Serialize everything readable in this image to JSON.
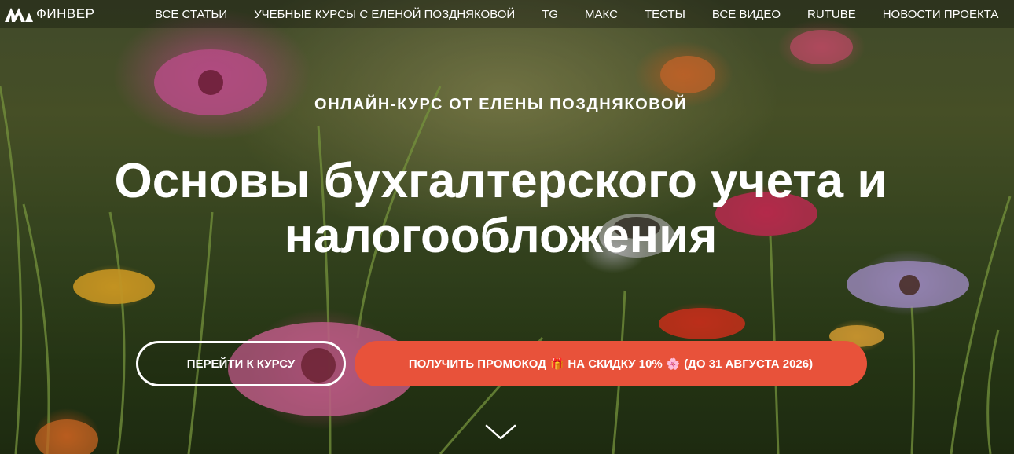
{
  "header": {
    "logo_text": "ФИНВЕР",
    "nav": [
      {
        "label": "ВСЕ СТАТЬИ"
      },
      {
        "label": "УЧЕБНЫЕ КУРСЫ С ЕЛЕНОЙ ПОЗДНЯКОВОЙ"
      },
      {
        "label": "TG"
      },
      {
        "label": "МАКС"
      },
      {
        "label": "ТЕСТЫ"
      },
      {
        "label": "ВСЕ ВИДЕО"
      },
      {
        "label": "RUTUBE"
      },
      {
        "label": "НОВОСТИ ПРОЕКТА"
      }
    ]
  },
  "hero": {
    "kicker": "ОНЛАЙН-КУРС ОТ ЕЛЕНЫ ПОЗДНЯКОВОЙ",
    "title_line1": "Основы бухгалтерского учета и",
    "title_line2": "налогообложения",
    "course_button": "ПЕРЕЙТИ К КУРСУ",
    "promo_button": {
      "part1": "ПОЛУЧИТЬ ПРОМОКОД",
      "gift_emoji": "🎁",
      "part2": "НА СКИДКУ 10%",
      "flower_emoji": "🌸",
      "part3": "(ДО 31 АВГУСТА 2026)"
    },
    "scroll_icon": "chevron-down-icon"
  },
  "colors": {
    "accent": "#e8523a",
    "text": "#ffffff"
  }
}
